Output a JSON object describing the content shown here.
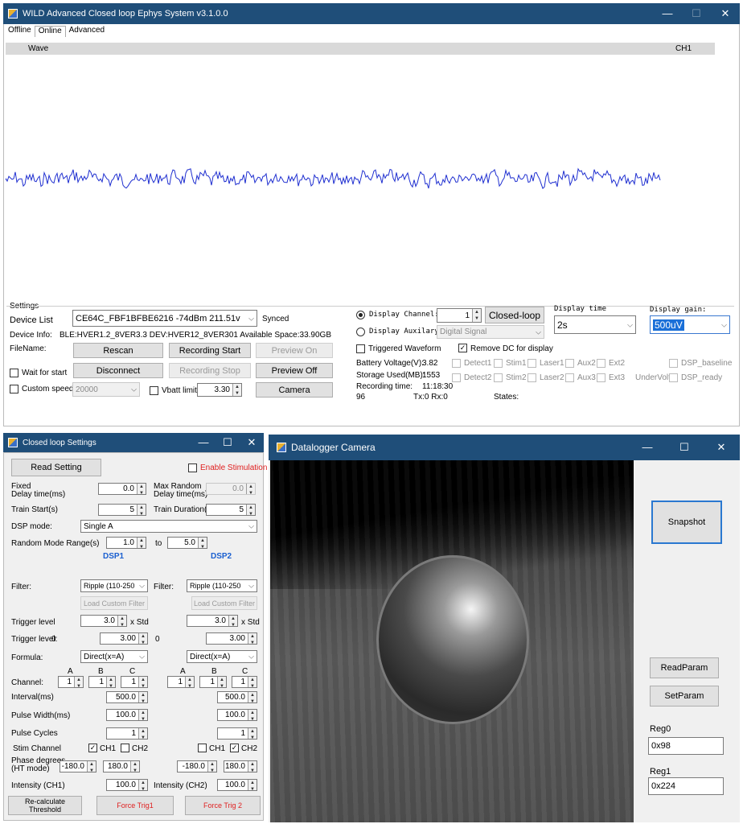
{
  "main": {
    "title": "WILD Advanced Closed loop Ephys System v3.1.0.0",
    "tabs": [
      "Offline",
      "Online",
      "Advanced"
    ],
    "wave_header": "Wave",
    "channel_label": "CH1",
    "settings_label": "Settings",
    "device_list_label": "Device List",
    "device_value": "CE64C_FBF1BFBE6216 -74dBm 211.51v",
    "synced": "Synced",
    "device_info_label": "Device Info:",
    "device_info_value": "BLE:HVER1.2_8VER3.3  DEV:HVER12_8VER301  Available Space:33.90GB",
    "filename_label": "FileName:",
    "rescan": "Rescan",
    "recording_start": "Recording Start",
    "preview_on": "Preview On",
    "disconnect": "Disconnect",
    "recording_stop": "Recording Stop",
    "preview_off": "Preview Off",
    "camera": "Camera",
    "wait_for_start": "Wait for start",
    "custom_speed": "Custom speed",
    "custom_speed_value": "20000",
    "vbatt_limit": "Vbatt limit",
    "vbatt_value": "3.30",
    "display_channel_label": "Display Channel:",
    "display_channel_value": "1",
    "closed_loop": "Closed-loop",
    "display_auxilary_label": "Display Auxilary:",
    "display_auxilary_value": "Digital Signal",
    "display_time_label": "Display time",
    "display_time_value": "2s",
    "display_gain_label": "Display gain:",
    "display_gain_value": "500uV",
    "triggered_waveform": "Triggered Waveform",
    "remove_dc": "Remove DC for display",
    "battery_label": "Battery Voltage(V):",
    "battery_value": "3.82",
    "storage_label": "Storage Used(MB):",
    "storage_value": "1553",
    "rec_time_label": "Recording time:",
    "rec_time_value": "11:18:30",
    "counter": "96",
    "txrx": "Tx:0 Rx:0",
    "states": "States:",
    "status_row1": [
      "Detect1",
      "Stim1",
      "Laser1",
      "Aux2",
      "Ext2"
    ],
    "status_row2": [
      "Detect2",
      "Stim2",
      "Laser2",
      "Aux3",
      "Ext3"
    ],
    "undervolt": "UnderVolt",
    "dsp_baseline": "DSP_baseline",
    "dsp_ready": "DSP_ready"
  },
  "closed_loop": {
    "title": "Closed loop Settings",
    "read_setting": "Read Setting",
    "enable_stim": "Enable Stimulation",
    "fixed_delay_label": "Fixed\nDelay time(ms)",
    "fixed_delay_value": "0.0",
    "max_random_label": "Max Random\nDelay time(ms)",
    "max_random_value": "0.0",
    "train_start_label": "Train Start(s)",
    "train_start_value": "5",
    "train_duration_label": "Train Duration(s)",
    "train_duration_value": "5",
    "dsp_mode_label": "DSP mode:",
    "dsp_mode_value": "Single A",
    "random_range_label": "Random Mode Range(s)",
    "random_from": "1.0",
    "to": "to",
    "random_to": "5.0",
    "dsp1": "DSP1",
    "dsp2": "DSP2",
    "filter_label": "Filter:",
    "filter_value": "Ripple    (110-250",
    "load_custom_filter": "Load Custom Filter",
    "trigger_level_label": "Trigger level",
    "trigger_std_value": "3.0",
    "x_std": "x Std",
    "trigger_level0_label": "Trigger level:",
    "zero": "0",
    "trigger_value": "3.00",
    "formula_label": "Formula:",
    "formula_value": "Direct(x=A)",
    "abc": [
      "A",
      "B",
      "C"
    ],
    "channel_label": "Channel:",
    "channel_value": "1",
    "interval_label": "Interval(ms)",
    "interval_value": "500.0",
    "pulse_width_label": "Pulse Width(ms)",
    "pulse_width_value": "100.0",
    "pulse_cycles_label": "Pulse Cycles",
    "pulse_cycles_value": "1",
    "stim_channel_label": "Stim Channel",
    "ch1": "CH1",
    "ch2": "CH2",
    "phase_label": "Phase degrees\n(HT mode)",
    "phase_from": "-180.0",
    "phase_to": "180.0",
    "intensity_ch1_label": "Intensity (CH1)",
    "intensity_ch2_label": "Intensity (CH2)",
    "intensity_value": "100.0",
    "recalc": "Re-calculate Threshold",
    "force_trig1": "Force Trig1",
    "force_trig2": "Force Trig 2"
  },
  "camera": {
    "title": "Datalogger Camera",
    "snapshot": "Snapshot",
    "read_param": "ReadParam",
    "set_param": "SetParam",
    "reg0_label": "Reg0",
    "reg0_value": "0x98",
    "reg1_label": "Reg1",
    "reg1_value": "0x224"
  },
  "colors": {
    "titlebar": "#1f4e79",
    "wave": "#1f2fd0",
    "accent_red": "#e02020",
    "accent_blue": "#1a5fd0"
  }
}
